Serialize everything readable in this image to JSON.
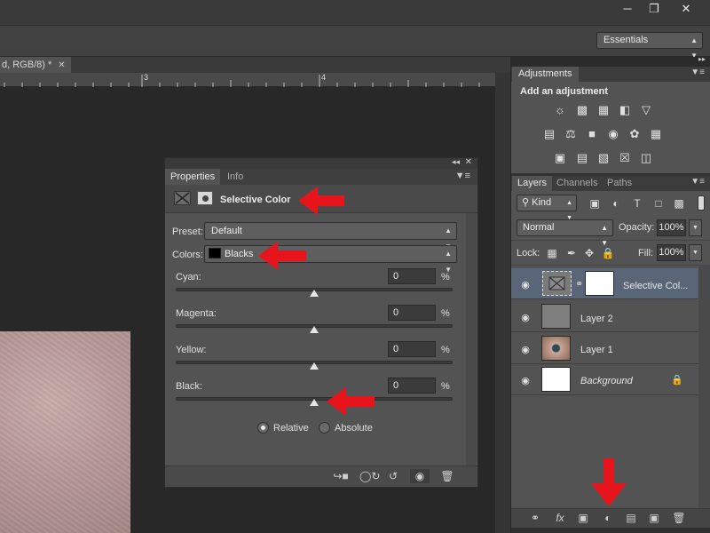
{
  "window": {
    "minimize_icon": "minimize-icon",
    "restore_icon": "restore-icon",
    "close_icon": "close-icon"
  },
  "workspace": {
    "selected": "Essentials"
  },
  "document": {
    "tab_label": "d, RGB/8) *",
    "ruler_numbers": [
      "3",
      "4"
    ]
  },
  "properties": {
    "tabs": [
      {
        "label": "Properties",
        "active": true
      },
      {
        "label": "Info",
        "active": false
      }
    ],
    "title": "Selective Color",
    "preset_label": "Preset:",
    "preset_value": "Default",
    "colors_label": "Colors:",
    "colors_value": "Blacks",
    "sliders": [
      {
        "label": "Cyan:",
        "value": "0",
        "unit": "%"
      },
      {
        "label": "Magenta:",
        "value": "0",
        "unit": "%"
      },
      {
        "label": "Yellow:",
        "value": "0",
        "unit": "%"
      },
      {
        "label": "Black:",
        "value": "0",
        "unit": "%"
      }
    ],
    "method_relative": "Relative",
    "method_absolute": "Absolute",
    "selected_method": "Relative"
  },
  "adjustments": {
    "tab_label": "Adjustments",
    "heading": "Add an adjustment"
  },
  "layers_panel": {
    "tabs": [
      {
        "label": "Layers",
        "active": true
      },
      {
        "label": "Channels",
        "active": false
      },
      {
        "label": "Paths",
        "active": false
      }
    ],
    "filter_kind": "Kind",
    "blend_mode": "Normal",
    "opacity_label": "Opacity:",
    "opacity_value": "100%",
    "lock_label": "Lock:",
    "fill_label": "Fill:",
    "fill_value": "100%",
    "layers": [
      {
        "name": "Selective Col...",
        "selected": true
      },
      {
        "name": "Layer 2",
        "selected": false
      },
      {
        "name": "Layer 1",
        "selected": false
      },
      {
        "name": "Background",
        "selected": false
      }
    ]
  },
  "colors": {
    "annotation_red": "#e8141c",
    "selected_layer": "#596678",
    "panel_bg": "#535353"
  }
}
